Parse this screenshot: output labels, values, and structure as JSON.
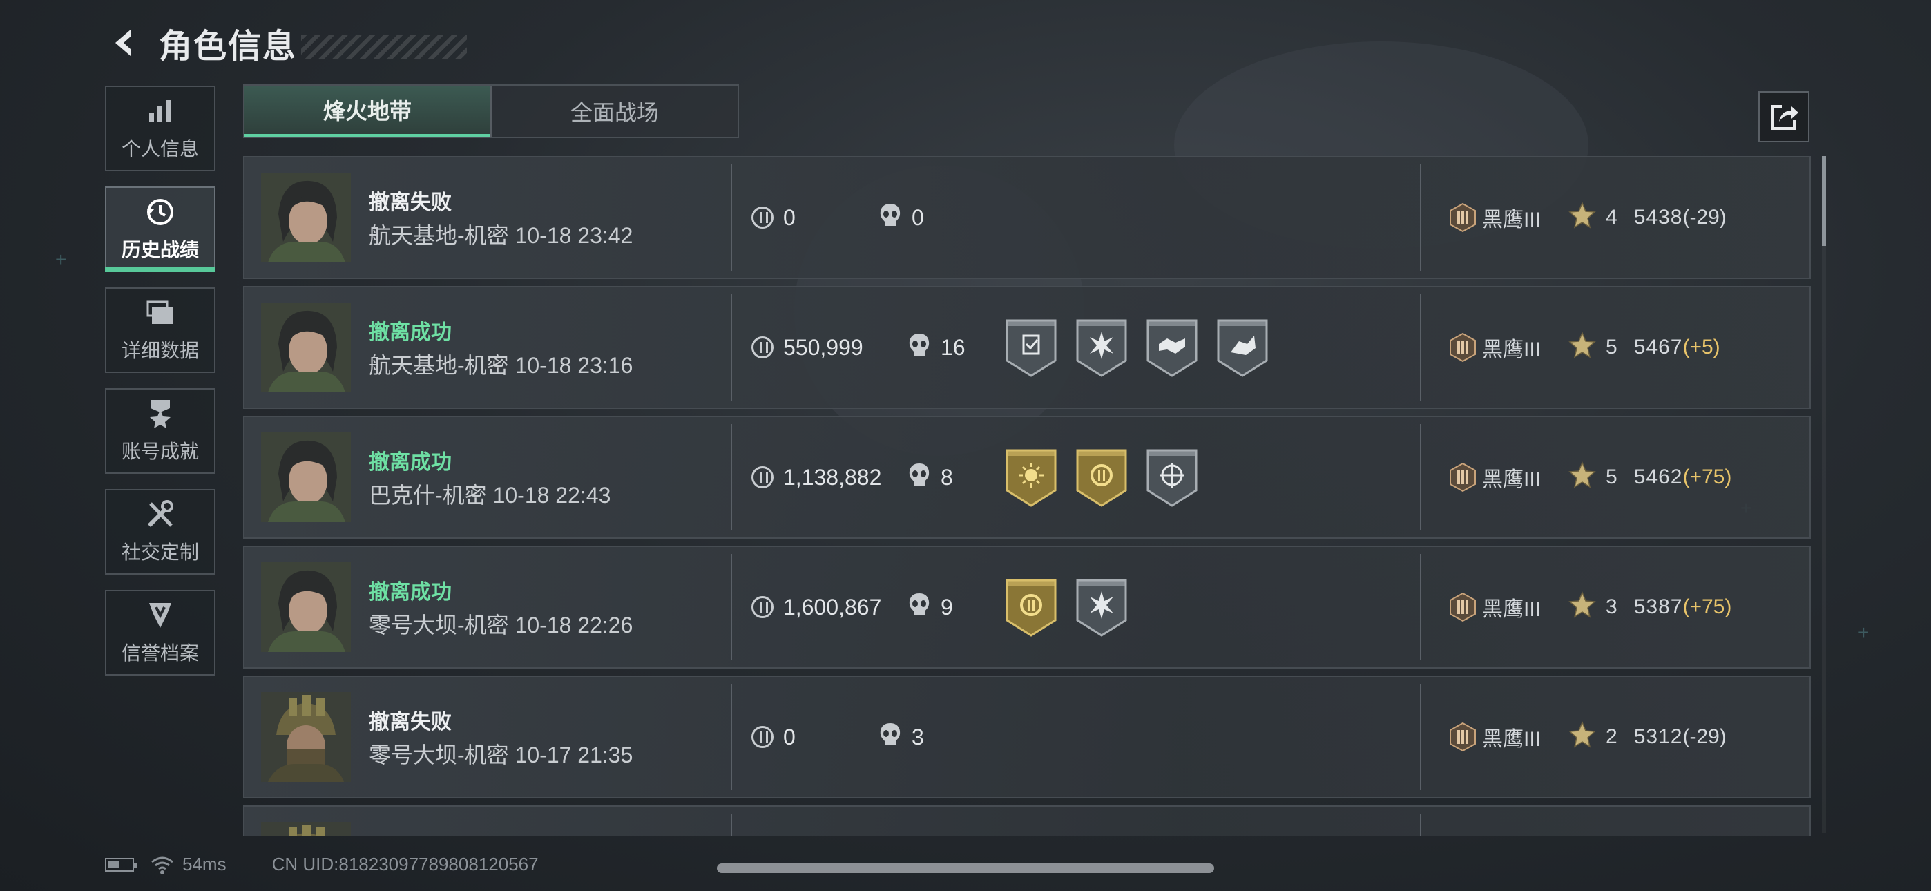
{
  "header": {
    "title": "角色信息"
  },
  "nav": [
    {
      "label": "个人信息",
      "icon": "bar-chart-icon",
      "active": false
    },
    {
      "label": "历史战绩",
      "icon": "history-icon",
      "active": true
    },
    {
      "label": "详细数据",
      "icon": "folders-icon",
      "active": false
    },
    {
      "label": "账号成就",
      "icon": "medal-icon",
      "active": false
    },
    {
      "label": "社交定制",
      "icon": "tools-icon",
      "active": false
    },
    {
      "label": "信誉档案",
      "icon": "shield-icon",
      "active": false
    }
  ],
  "tabs": [
    {
      "label": "烽火地带",
      "active": true
    },
    {
      "label": "全面战场",
      "active": false
    }
  ],
  "share_icon": "share-icon",
  "matches": [
    {
      "status": "撤离失败",
      "success": false,
      "map": "航天基地-机密",
      "time": "10-18 23:42",
      "coins": "0",
      "kills": "0",
      "badges": [],
      "rank": "黑鹰III",
      "level": "4",
      "score": "5438",
      "delta": "(-29)",
      "delta_positive": false,
      "avatar": "female"
    },
    {
      "status": "撤离成功",
      "success": true,
      "map": "航天基地-机密",
      "time": "10-18 23:16",
      "coins": "550,999",
      "kills": "16",
      "badges": [
        "silver-checklist",
        "silver-burst",
        "silver-handshake",
        "silver-runner"
      ],
      "rank": "黑鹰III",
      "level": "5",
      "score": "5467",
      "delta": "(+5)",
      "delta_positive": true,
      "avatar": "female"
    },
    {
      "status": "撤离成功",
      "success": true,
      "map": "巴克什-机密",
      "time": "10-18 22:43",
      "coins": "1,138,882",
      "kills": "8",
      "badges": [
        "gold-sun",
        "gold-coin",
        "silver-target"
      ],
      "rank": "黑鹰III",
      "level": "5",
      "score": "5462",
      "delta": "(+75)",
      "delta_positive": true,
      "avatar": "female"
    },
    {
      "status": "撤离成功",
      "success": true,
      "map": "零号大坝-机密",
      "time": "10-18 22:26",
      "coins": "1,600,867",
      "kills": "9",
      "badges": [
        "gold-coin",
        "silver-burst"
      ],
      "rank": "黑鹰III",
      "level": "3",
      "score": "5387",
      "delta": "(+75)",
      "delta_positive": true,
      "avatar": "female"
    },
    {
      "status": "撤离失败",
      "success": false,
      "map": "零号大坝-机密",
      "time": "10-17 21:35",
      "coins": "0",
      "kills": "3",
      "badges": [],
      "rank": "黑鹰III",
      "level": "2",
      "score": "5312",
      "delta": "(-29)",
      "delta_positive": false,
      "avatar": "helmet"
    }
  ],
  "footer": {
    "ping": "54ms",
    "uid": "CN UID:81823097789808120567"
  },
  "colors": {
    "accent": "#5fd0a2",
    "success": "#6ee0a4",
    "gold": "#e8c46a"
  }
}
